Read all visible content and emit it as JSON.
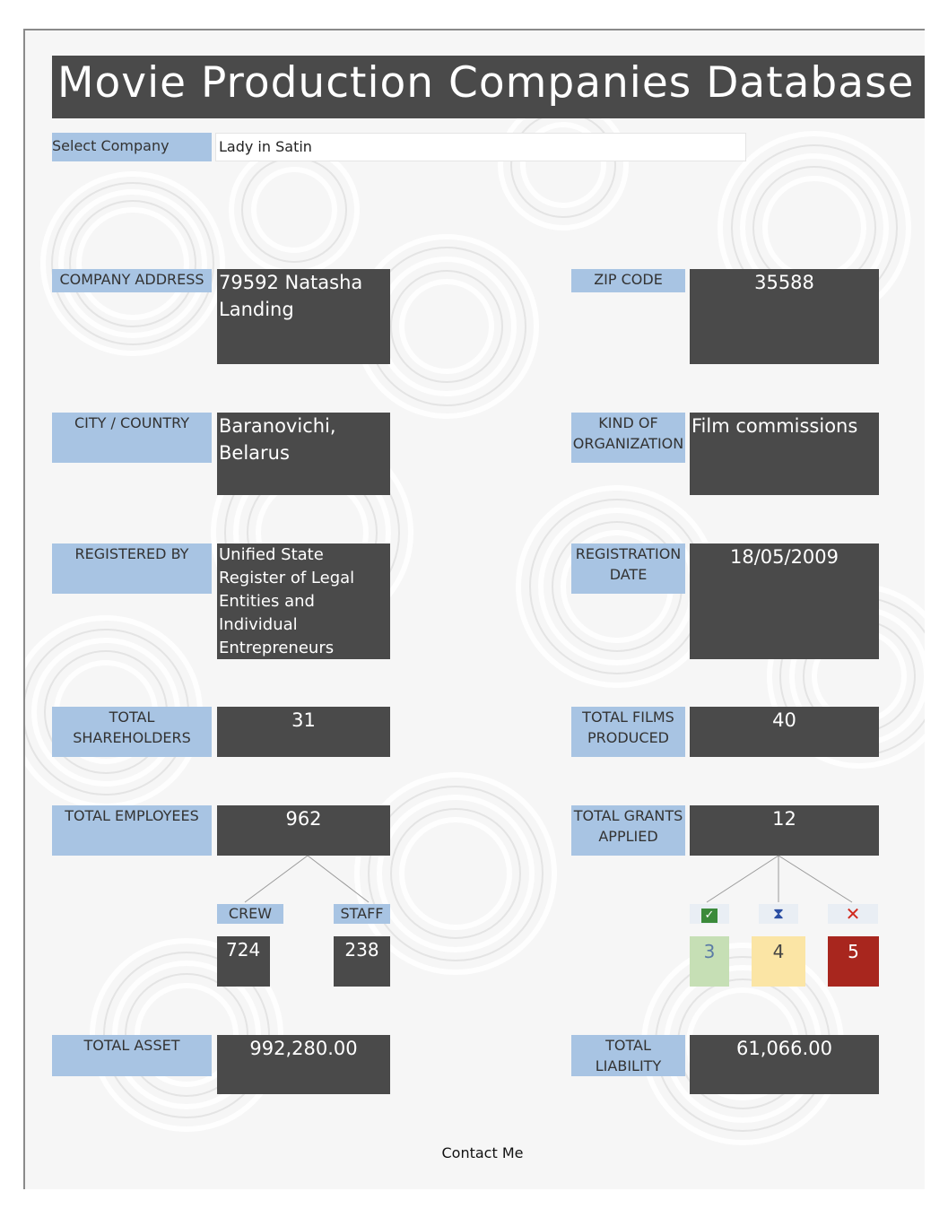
{
  "header": {
    "title": "Movie Production Companies Database - EU"
  },
  "select": {
    "label": "Select Company",
    "value": "Lady in Satin"
  },
  "fields": {
    "company_address": {
      "label": "COMPANY ADDRESS",
      "value": "79592 Natasha Landing"
    },
    "zip_code": {
      "label": "ZIP CODE",
      "value": "35588"
    },
    "city_country": {
      "label": "CITY / COUNTRY",
      "value": "Baranovichi, Belarus"
    },
    "kind_of_org": {
      "label": "KIND OF ORGANIZATION",
      "value": "Film commissions"
    },
    "registered_by": {
      "label": "REGISTERED BY",
      "value": "Unified State Register of Legal Entities and Individual Entrepreneurs"
    },
    "registration_date": {
      "label": "REGISTRATION DATE",
      "value": "18/05/2009"
    },
    "total_shareholders": {
      "label": "TOTAL SHAREHOLDERS",
      "value": "31"
    },
    "total_films": {
      "label": "TOTAL FILMS PRODUCED",
      "value": "40"
    },
    "total_employees": {
      "label": "TOTAL EMPLOYEES",
      "value": "962"
    },
    "total_grants": {
      "label": "TOTAL GRANTS APPLIED",
      "value": "12"
    },
    "total_asset": {
      "label": "TOTAL ASSET",
      "value": "992,280.00"
    },
    "total_liability": {
      "label": "TOTAL LIABILITY",
      "value": "61,066.00"
    }
  },
  "employees_breakdown": {
    "crew": {
      "label": "CREW",
      "value": "724"
    },
    "staff": {
      "label": "STAFF",
      "value": "238"
    }
  },
  "grants_breakdown": {
    "approved": {
      "icon": "check-icon",
      "value": "3",
      "color": "#c6dfb5"
    },
    "pending": {
      "icon": "hourglass-icon",
      "value": "4",
      "color": "#fbe5a5"
    },
    "rejected": {
      "icon": "cross-icon",
      "value": "5",
      "color": "#a8261e"
    }
  },
  "footer": {
    "contact": "Contact Me"
  }
}
